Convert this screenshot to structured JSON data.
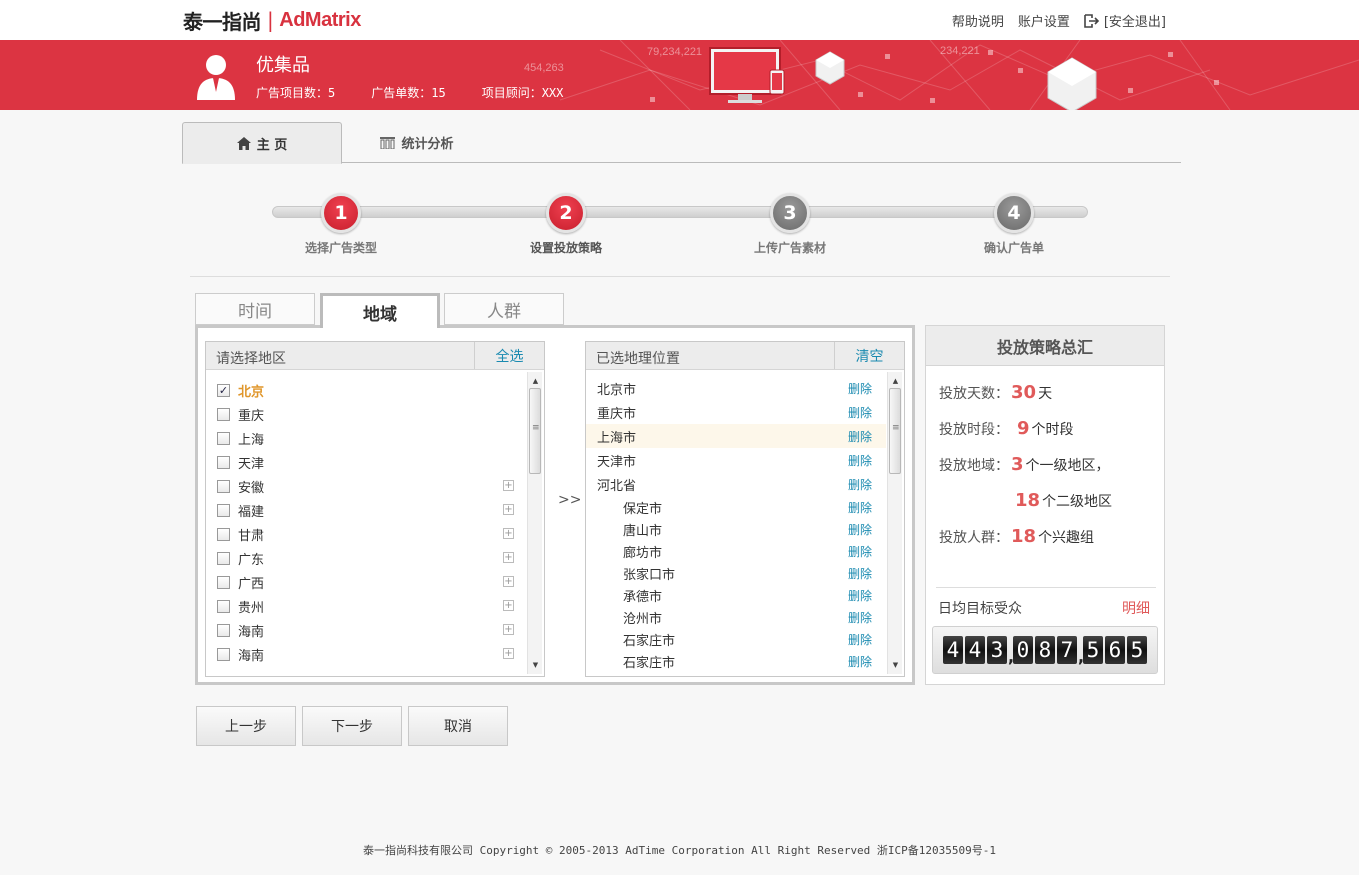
{
  "header": {
    "logo_cn": "泰一指尚",
    "logo_sep": "|",
    "logo_en": "AdMatrix",
    "links": [
      "帮助说明",
      "账户设置"
    ],
    "logout": "[安全退出]"
  },
  "banner": {
    "company": "优集品",
    "stats": [
      "广告项目数：5",
      "广告单数：15",
      "项目顾问：XXX"
    ],
    "ghost_numbers": [
      "79,234,221",
      "454,263",
      "234,221"
    ]
  },
  "main_tabs": [
    {
      "label": "主  页",
      "icon": "home-icon",
      "active": true
    },
    {
      "label": "统计分析",
      "icon": "chart-icon",
      "active": false
    }
  ],
  "steps": [
    {
      "num": "1",
      "label": "选择广告类型",
      "state": "done"
    },
    {
      "num": "2",
      "label": "设置投放策略",
      "state": "current"
    },
    {
      "num": "3",
      "label": "上传广告素材",
      "state": "todo"
    },
    {
      "num": "4",
      "label": "确认广告单",
      "state": "todo"
    }
  ],
  "sub_tabs": [
    "时间",
    "地域",
    "人群"
  ],
  "region_list": {
    "title": "请选择地区",
    "action": "全选",
    "items": [
      {
        "name": "北京",
        "checked": true,
        "expand": false
      },
      {
        "name": "重庆",
        "checked": false,
        "expand": false
      },
      {
        "name": "上海",
        "checked": false,
        "expand": false
      },
      {
        "name": "天津",
        "checked": false,
        "expand": false
      },
      {
        "name": "安徽",
        "checked": false,
        "expand": true
      },
      {
        "name": "福建",
        "checked": false,
        "expand": true
      },
      {
        "name": "甘肃",
        "checked": false,
        "expand": true
      },
      {
        "name": "广东",
        "checked": false,
        "expand": true
      },
      {
        "name": "广西",
        "checked": false,
        "expand": true
      },
      {
        "name": "贵州",
        "checked": false,
        "expand": true
      },
      {
        "name": "海南",
        "checked": false,
        "expand": true
      },
      {
        "name": "海南",
        "checked": false,
        "expand": true
      }
    ]
  },
  "move_arrow": ">>",
  "selected_list": {
    "title": "已选地理位置",
    "action": "清空",
    "delete_label": "删除",
    "items": [
      {
        "name": "北京市",
        "sub": false,
        "highlight": false
      },
      {
        "name": "重庆市",
        "sub": false,
        "highlight": false
      },
      {
        "name": "上海市",
        "sub": false,
        "highlight": true
      },
      {
        "name": "天津市",
        "sub": false,
        "highlight": false
      },
      {
        "name": "河北省",
        "sub": false,
        "highlight": false
      },
      {
        "name": "保定市",
        "sub": true,
        "highlight": false
      },
      {
        "name": "唐山市",
        "sub": true,
        "highlight": false
      },
      {
        "name": "廊坊市",
        "sub": true,
        "highlight": false
      },
      {
        "name": "张家口市",
        "sub": true,
        "highlight": false
      },
      {
        "name": "承德市",
        "sub": true,
        "highlight": false
      },
      {
        "name": "沧州市",
        "sub": true,
        "highlight": false
      },
      {
        "name": "石家庄市",
        "sub": true,
        "highlight": false
      },
      {
        "name": "石家庄市",
        "sub": true,
        "highlight": false
      }
    ]
  },
  "summary": {
    "title": "投放策略总汇",
    "days_label": "投放天数：",
    "days": "30",
    "days_unit": "天",
    "slots_label": "投放时段：",
    "slots": "9",
    "slots_unit": "个时段",
    "region_label": "投放地域：",
    "region_l1": "3",
    "region_l1_unit": "个一级地区，",
    "region_l2": "18",
    "region_l2_unit": "个二级地区",
    "crowd_label": "投放人群：",
    "crowd": "18",
    "crowd_unit": "个兴趣组",
    "audience_label": "日均目标受众",
    "detail_link": "明细",
    "audience_digits": [
      "4",
      "4",
      "3",
      ",",
      "0",
      "8",
      "7",
      ",",
      "5",
      "6",
      "5"
    ]
  },
  "buttons": {
    "prev": "上一步",
    "next": "下一步",
    "cancel": "取消"
  },
  "footer": "泰一指尚科技有限公司 Copyright © 2005-2013 AdTime Corporation All Right Reserved 浙ICP备12035509号-1",
  "colors": {
    "brand_red": "#dc3442",
    "link_blue": "#1a8ab0",
    "accent_red": "#e05a5a"
  }
}
